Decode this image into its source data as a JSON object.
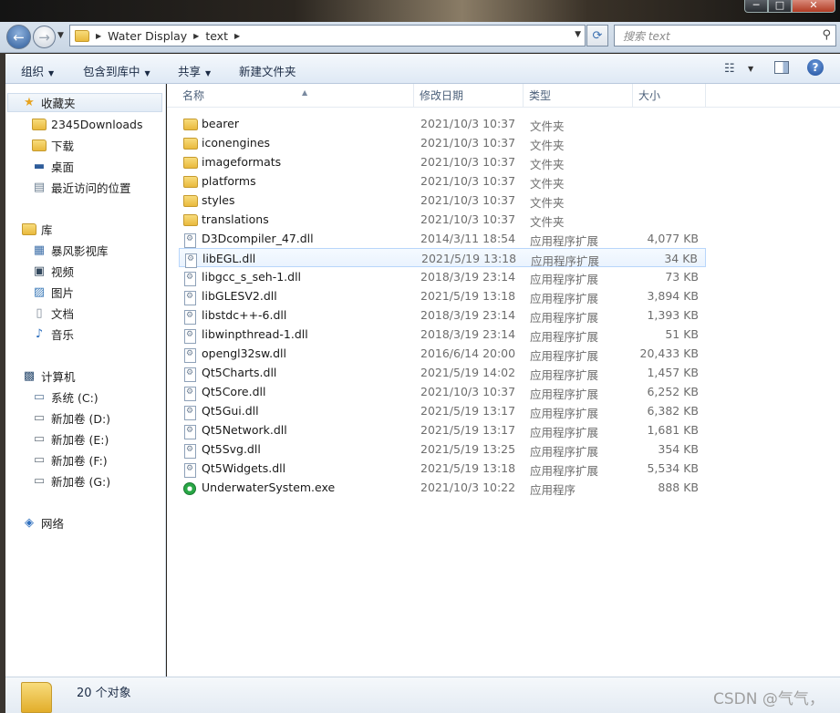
{
  "window": {
    "controls": {
      "minimize": "─",
      "maximize": "□",
      "close": "✕"
    }
  },
  "address": {
    "path": [
      "Water Display",
      "text"
    ],
    "search_placeholder": "搜索 text"
  },
  "toolbar": {
    "organize": "组织",
    "include_in_library": "包含到库中",
    "share": "共享",
    "new_folder": "新建文件夹",
    "help": "?"
  },
  "nav": {
    "favorites_header": "收藏夹",
    "favorites": [
      "2345Downloads",
      "下载",
      "桌面",
      "最近访问的位置"
    ],
    "libraries_header": "库",
    "libraries": [
      "暴风影视库",
      "视频",
      "图片",
      "文档",
      "音乐"
    ],
    "computer_header": "计算机",
    "drives": [
      "系统 (C:)",
      "新加卷 (D:)",
      "新加卷 (E:)",
      "新加卷 (F:)",
      "新加卷 (G:)"
    ],
    "network_header": "网络"
  },
  "columns": {
    "name": "名称",
    "modified": "修改日期",
    "type": "类型",
    "size": "大小"
  },
  "files": [
    {
      "name": "bearer",
      "date": "2021/10/3 10:37",
      "type": "文件夹",
      "size": "",
      "kind": "folder"
    },
    {
      "name": "iconengines",
      "date": "2021/10/3 10:37",
      "type": "文件夹",
      "size": "",
      "kind": "folder"
    },
    {
      "name": "imageformats",
      "date": "2021/10/3 10:37",
      "type": "文件夹",
      "size": "",
      "kind": "folder"
    },
    {
      "name": "platforms",
      "date": "2021/10/3 10:37",
      "type": "文件夹",
      "size": "",
      "kind": "folder"
    },
    {
      "name": "styles",
      "date": "2021/10/3 10:37",
      "type": "文件夹",
      "size": "",
      "kind": "folder"
    },
    {
      "name": "translations",
      "date": "2021/10/3 10:37",
      "type": "文件夹",
      "size": "",
      "kind": "folder"
    },
    {
      "name": "D3Dcompiler_47.dll",
      "date": "2014/3/11 18:54",
      "type": "应用程序扩展",
      "size": "4,077 KB",
      "kind": "dll"
    },
    {
      "name": "libEGL.dll",
      "date": "2021/5/19 13:18",
      "type": "应用程序扩展",
      "size": "34 KB",
      "kind": "dll"
    },
    {
      "name": "libgcc_s_seh-1.dll",
      "date": "2018/3/19 23:14",
      "type": "应用程序扩展",
      "size": "73 KB",
      "kind": "dll"
    },
    {
      "name": "libGLESV2.dll",
      "date": "2021/5/19 13:18",
      "type": "应用程序扩展",
      "size": "3,894 KB",
      "kind": "dll"
    },
    {
      "name": "libstdc++-6.dll",
      "date": "2018/3/19 23:14",
      "type": "应用程序扩展",
      "size": "1,393 KB",
      "kind": "dll"
    },
    {
      "name": "libwinpthread-1.dll",
      "date": "2018/3/19 23:14",
      "type": "应用程序扩展",
      "size": "51 KB",
      "kind": "dll"
    },
    {
      "name": "opengl32sw.dll",
      "date": "2016/6/14 20:00",
      "type": "应用程序扩展",
      "size": "20,433 KB",
      "kind": "dll"
    },
    {
      "name": "Qt5Charts.dll",
      "date": "2021/5/19 14:02",
      "type": "应用程序扩展",
      "size": "1,457 KB",
      "kind": "dll"
    },
    {
      "name": "Qt5Core.dll",
      "date": "2021/10/3 10:37",
      "type": "应用程序扩展",
      "size": "6,252 KB",
      "kind": "dll"
    },
    {
      "name": "Qt5Gui.dll",
      "date": "2021/5/19 13:17",
      "type": "应用程序扩展",
      "size": "6,382 KB",
      "kind": "dll"
    },
    {
      "name": "Qt5Network.dll",
      "date": "2021/5/19 13:17",
      "type": "应用程序扩展",
      "size": "1,681 KB",
      "kind": "dll"
    },
    {
      "name": "Qt5Svg.dll",
      "date": "2021/5/19 13:25",
      "type": "应用程序扩展",
      "size": "354 KB",
      "kind": "dll"
    },
    {
      "name": "Qt5Widgets.dll",
      "date": "2021/5/19 13:18",
      "type": "应用程序扩展",
      "size": "5,534 KB",
      "kind": "dll"
    },
    {
      "name": "UnderwaterSystem.exe",
      "date": "2021/10/3 10:22",
      "type": "应用程序",
      "size": "888 KB",
      "kind": "exe"
    }
  ],
  "status": {
    "item_count": "20 个对象"
  },
  "watermark": "CSDN @气气，"
}
